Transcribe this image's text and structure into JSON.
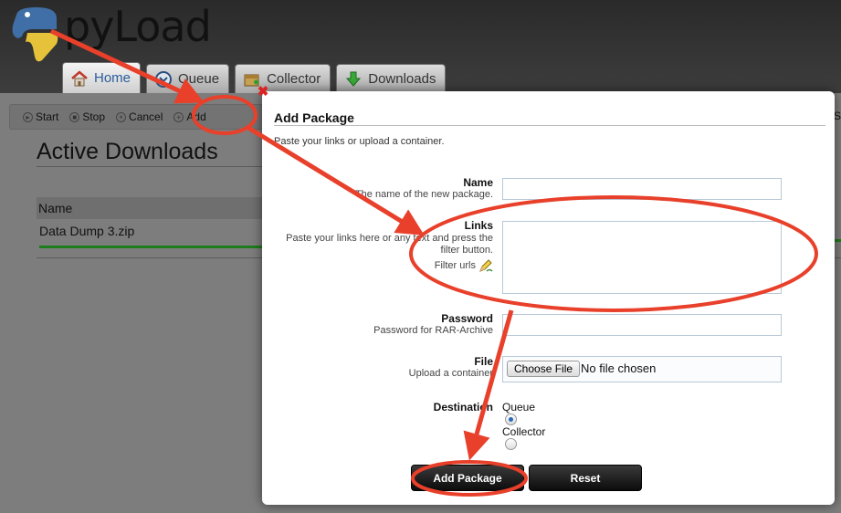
{
  "app": {
    "logo_text": "pyLoad",
    "tabs": [
      {
        "label": "Home",
        "icon": "home-icon"
      },
      {
        "label": "Queue",
        "icon": "queue-icon"
      },
      {
        "label": "Collector",
        "icon": "collector-icon"
      },
      {
        "label": "Downloads",
        "icon": "downloads-icon"
      }
    ]
  },
  "toolbar": {
    "start": "Start",
    "stop": "Stop",
    "cancel": "Cancel",
    "add": "Add"
  },
  "page": {
    "title": "Active Downloads",
    "column_name": "Name",
    "rows": [
      {
        "name": "Data Dump 3.zip",
        "progress_percent": 100
      }
    ],
    "edge_letter": "S"
  },
  "modal": {
    "title": "Add Package",
    "subtitle": "Paste your links or upload a container.",
    "name_label": "Name",
    "name_hint": "The name of the new package.",
    "links_label": "Links",
    "links_hint_1": "Paste your links here or any text and press the",
    "links_hint_2": "filter button.",
    "filter_label": "Filter urls",
    "password_label": "Password",
    "password_hint": "Password for RAR-Archive",
    "file_label": "File",
    "file_hint": "Upload a container",
    "file_button": "Choose File",
    "file_status": "No file chosen",
    "destination_label": "Destination",
    "destination_options": [
      {
        "label": "Queue",
        "selected": true
      },
      {
        "label": "Collector",
        "selected": false
      }
    ],
    "submit": "Add Package",
    "reset": "Reset"
  },
  "colors": {
    "annotation": "#e8402a",
    "progress": "#1d9e1d",
    "tab_active_text": "#2c5d9c"
  }
}
